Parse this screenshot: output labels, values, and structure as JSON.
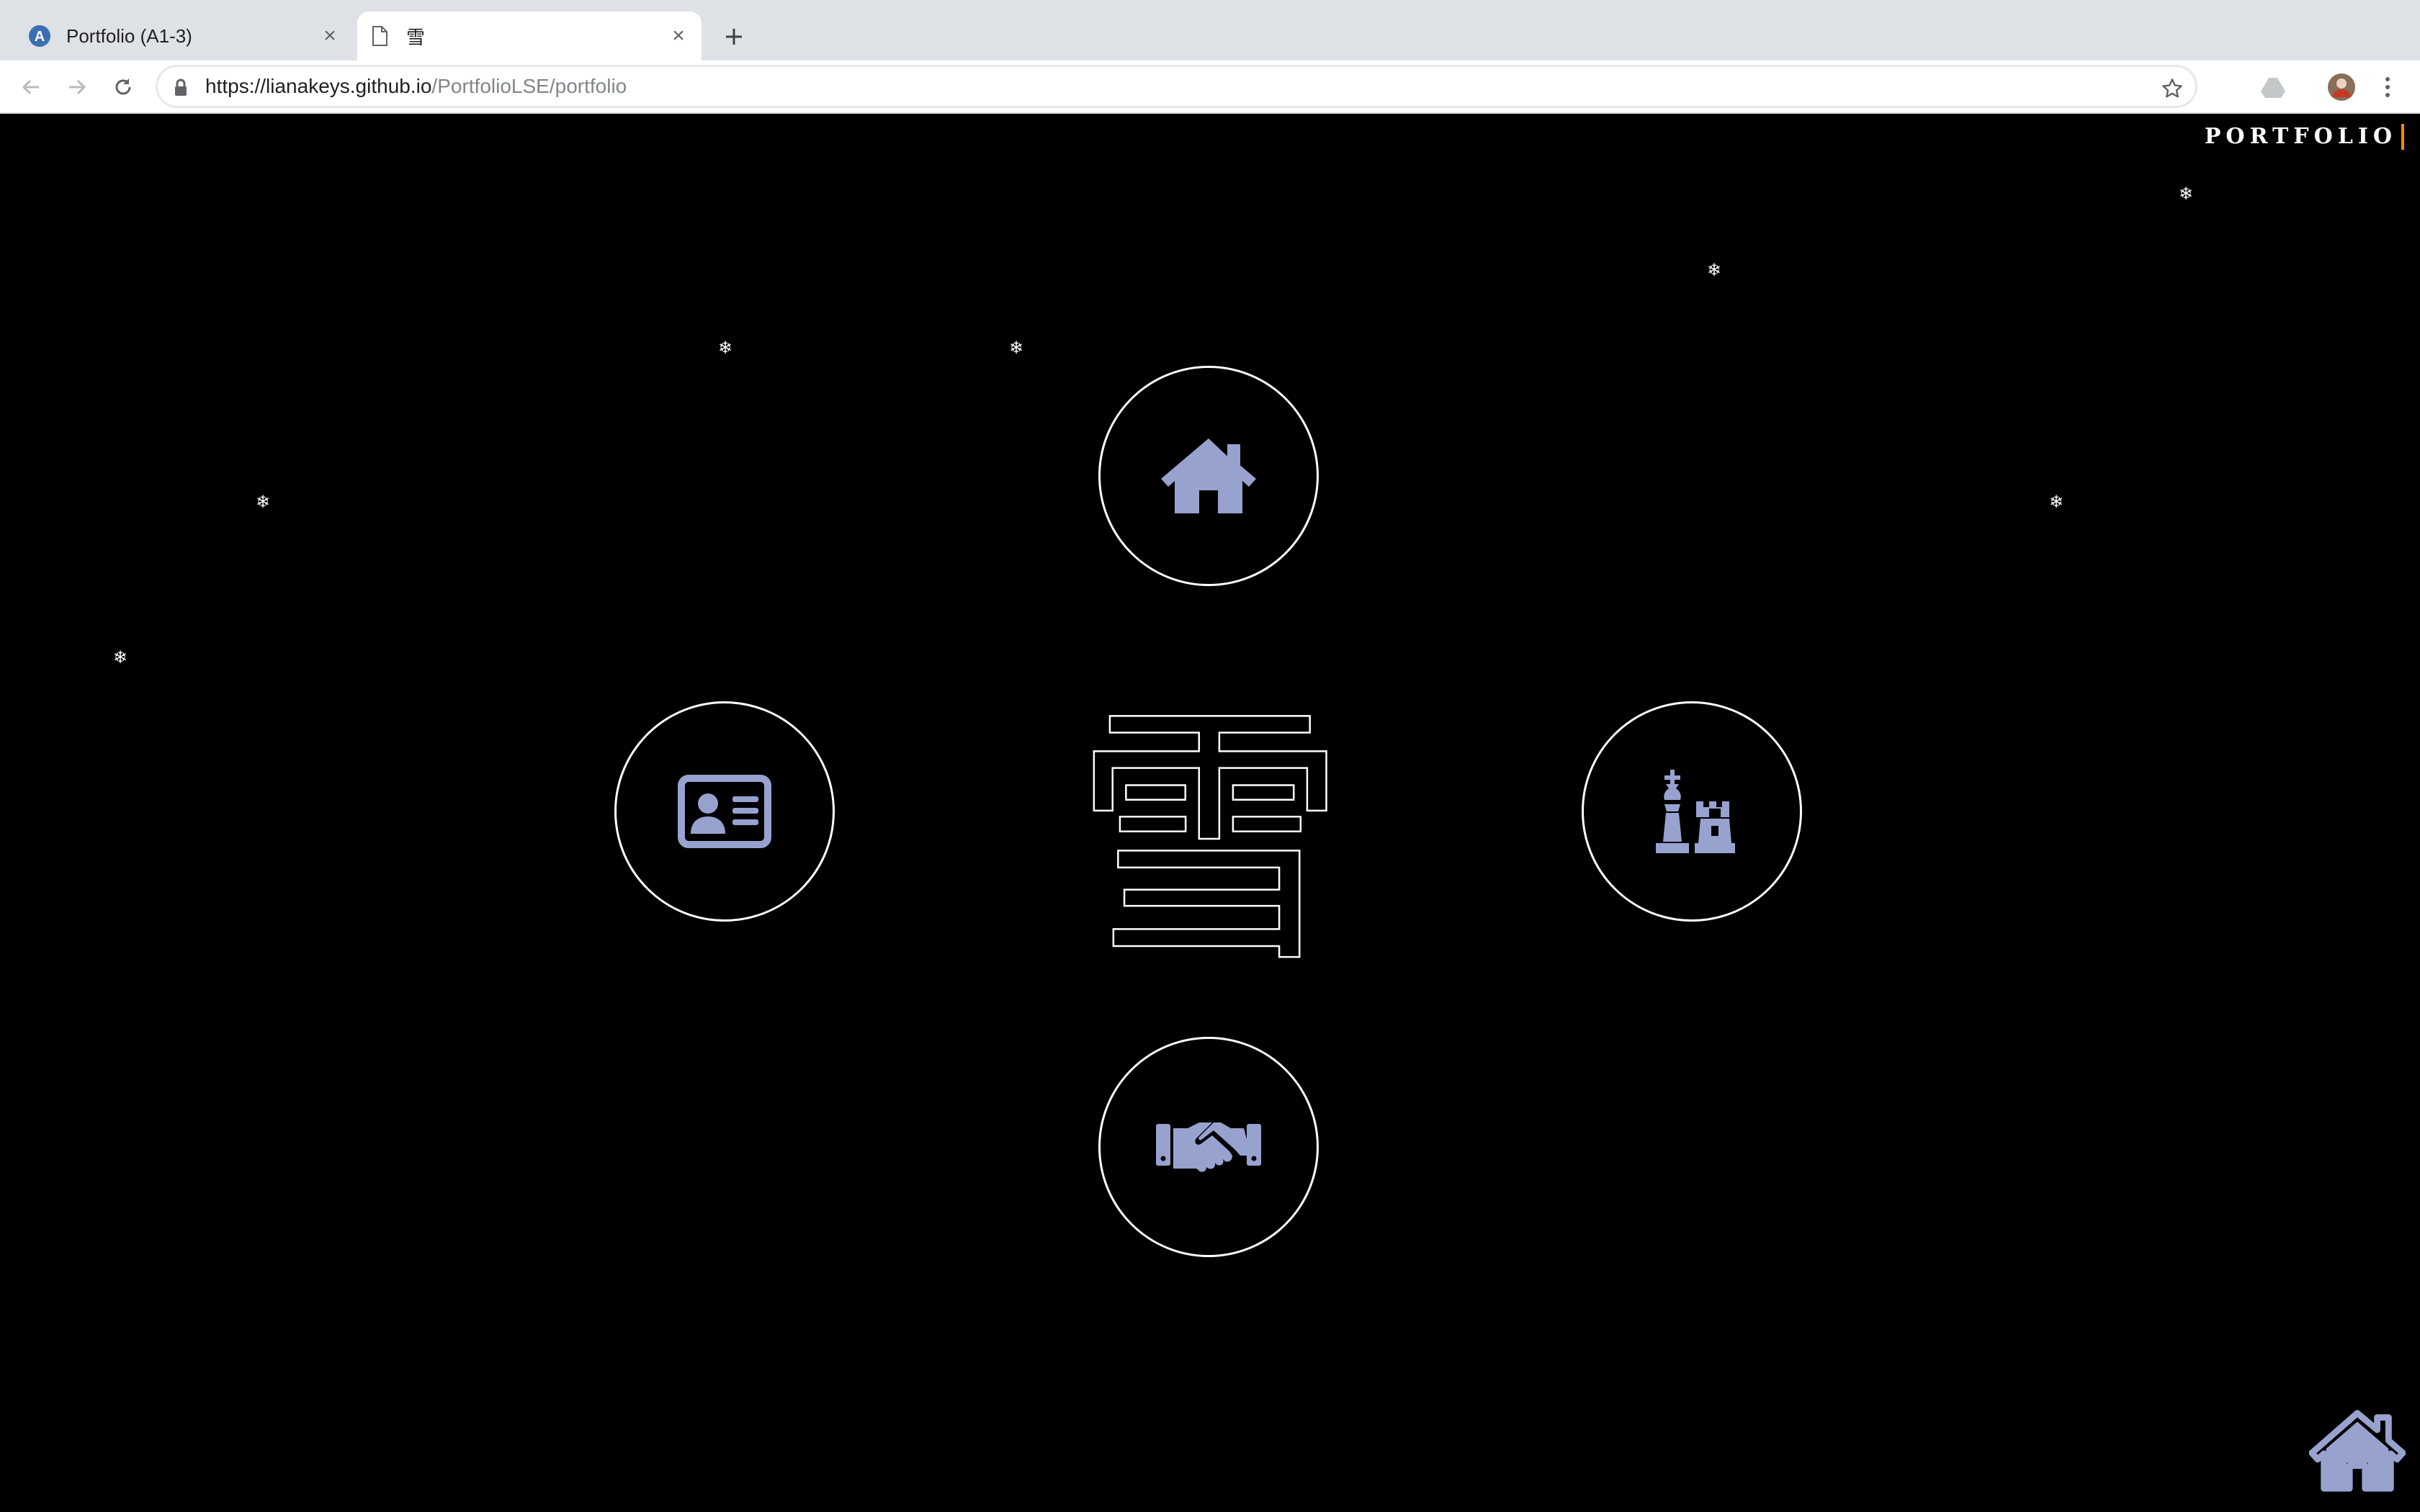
{
  "browser": {
    "tabs": [
      {
        "title": "Portfolio (A1-3)",
        "active": false
      },
      {
        "title": "雪",
        "active": true
      }
    ],
    "url_host": "https://lianakeys.github.io",
    "url_path": "/PortfolioLSE/portfolio"
  },
  "page": {
    "brand": "PORTFOLIO",
    "center_character": "雪",
    "icon_color": "#98a2cf",
    "nav": [
      {
        "name": "home",
        "icon": "home-icon"
      },
      {
        "name": "about",
        "icon": "id-card-icon"
      },
      {
        "name": "projects",
        "icon": "chess-icon"
      },
      {
        "name": "contact",
        "icon": "handshake-icon"
      }
    ],
    "snowflake": "❄",
    "corner_icon": "home-icon"
  }
}
